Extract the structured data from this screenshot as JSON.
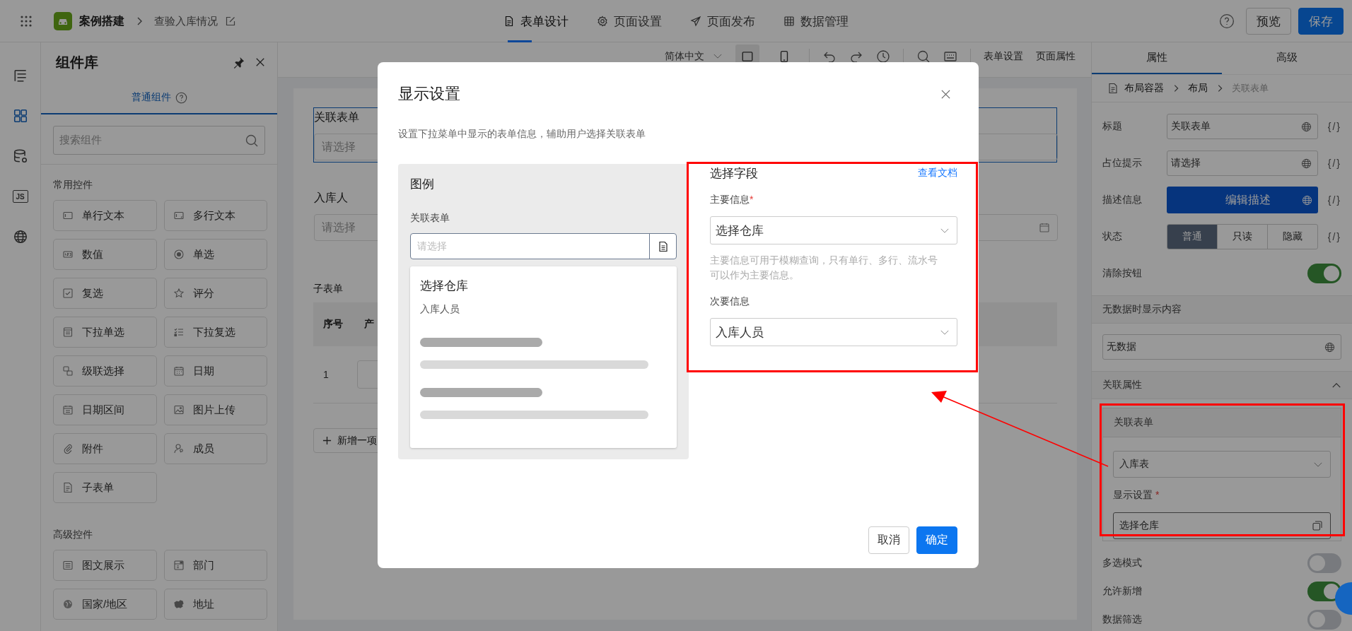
{
  "topbar": {
    "app": "案例搭建",
    "page": "查验入库情况",
    "tabs": [
      {
        "label": "表单设计",
        "kind": "form",
        "selected": true
      },
      {
        "label": "页面设置",
        "kind": "settings",
        "selected": false
      },
      {
        "label": "页面发布",
        "kind": "publish",
        "selected": false
      },
      {
        "label": "数据管理",
        "kind": "data",
        "selected": false
      }
    ],
    "buttons": [
      {
        "label": "预览",
        "kind": "default"
      },
      {
        "label": "保存",
        "kind": "primary"
      }
    ]
  },
  "rail": [
    {
      "kind": "outline",
      "selected": false
    },
    {
      "kind": "components",
      "selected": true
    },
    {
      "kind": "datasource",
      "selected": false
    },
    {
      "kind": "script",
      "label": "JS",
      "selected": false
    },
    {
      "kind": "i18n",
      "selected": false
    }
  ],
  "library": {
    "title": "组件库",
    "tab": "普通组件",
    "search": {
      "placeholder": "搜索组件"
    },
    "sections": [
      {
        "title": "常用控件",
        "items": [
          {
            "label": "单行文本",
            "kind": "single_line"
          },
          {
            "label": "多行文本",
            "kind": "multi_line"
          },
          {
            "label": "数值",
            "kind": "number"
          },
          {
            "label": "单选",
            "kind": "radio"
          },
          {
            "label": "复选",
            "kind": "checkbox"
          },
          {
            "label": "评分",
            "kind": "rating"
          },
          {
            "label": "下拉单选",
            "kind": "dropdown"
          },
          {
            "label": "下拉复选",
            "kind": "multi_dropdown"
          },
          {
            "label": "级联选择",
            "kind": "cascade"
          },
          {
            "label": "日期",
            "kind": "date"
          },
          {
            "label": "日期区间",
            "kind": "date_range"
          },
          {
            "label": "图片上传",
            "kind": "image"
          },
          {
            "label": "附件",
            "kind": "attachment"
          },
          {
            "label": "成员",
            "kind": "member"
          },
          {
            "label": "子表单",
            "kind": "subform"
          }
        ]
      },
      {
        "title": "高级控件",
        "items": [
          {
            "label": "图文展示",
            "kind": "rich_text"
          },
          {
            "label": "部门",
            "kind": "department"
          },
          {
            "label": "国家/地区",
            "kind": "country"
          },
          {
            "label": "地址",
            "kind": "address"
          }
        ]
      }
    ]
  },
  "canvas": {
    "toolbar": {
      "language": "简体中文",
      "views": [
        {
          "kind": "desktop",
          "selected": true
        },
        {
          "kind": "mobile",
          "selected": false
        }
      ],
      "links": [
        "表单设置",
        "页面属性"
      ]
    },
    "fields": [
      {
        "label": "关联表单",
        "placeholder": "请选择",
        "kind": "select",
        "selected": true
      },
      {
        "label": "入库人",
        "placeholder": "请选择",
        "kind": "date",
        "selected": false
      }
    ],
    "subform": {
      "title": "子表单",
      "columns": [
        "序号",
        "产"
      ],
      "rows": [
        {
          "index": "1"
        }
      ],
      "add_button": "新增一项"
    }
  },
  "properties": {
    "tabs": [
      {
        "label": "属性",
        "selected": true
      },
      {
        "label": "高级",
        "selected": false
      }
    ],
    "breadcrumb": [
      "布局容器",
      "布局",
      "关联表单"
    ],
    "rows": [
      {
        "kind": "input",
        "label": "标题",
        "value": "关联表单",
        "binding": "{/}"
      },
      {
        "kind": "input",
        "label": "占位提示",
        "value": "请选择",
        "binding": "{/}"
      },
      {
        "kind": "button",
        "label": "描述信息",
        "value": "编辑描述",
        "binding": "{/}"
      },
      {
        "kind": "segmented",
        "label": "状态",
        "options": [
          {
            "label": "普通",
            "selected": true
          },
          {
            "label": "只读",
            "selected": false
          },
          {
            "label": "隐藏",
            "selected": false
          }
        ],
        "binding": "{/}"
      },
      {
        "kind": "toggle",
        "label": "清除按钮",
        "on": true
      }
    ],
    "empty_section": {
      "title": "无数据时显示内容",
      "value": "无数据"
    },
    "relation_section": {
      "title": "关联属性",
      "expanded": true,
      "form_title": "关联表单",
      "form_value": "入库表",
      "display_label": "显示设置",
      "display_required": "*",
      "display_value": "选择仓库"
    },
    "toggles": [
      {
        "label": "多选模式",
        "on": false
      },
      {
        "label": "允许新增",
        "on": true
      },
      {
        "label": "数据筛选",
        "on": false
      }
    ]
  },
  "dialog": {
    "title": "显示设置",
    "description": "设置下拉菜单中显示的表单信息，辅助用户选择关联表单",
    "preview": {
      "title": "图例",
      "field_label": "关联表单",
      "placeholder": "请选择",
      "primary": "选择仓库",
      "secondary": "入库人员"
    },
    "fields": {
      "title": "选择字段",
      "link": "查看文档",
      "items": [
        {
          "label": "主要信息",
          "required": "*",
          "value": "选择仓库",
          "help": "主要信息可用于模糊查询，只有单行、多行、流水号可以作为主要信息。"
        },
        {
          "label": "次要信息",
          "value": "入库人员"
        }
      ]
    },
    "buttons": [
      {
        "label": "取消",
        "kind": "default"
      },
      {
        "label": "确定",
        "kind": "primary"
      }
    ]
  }
}
